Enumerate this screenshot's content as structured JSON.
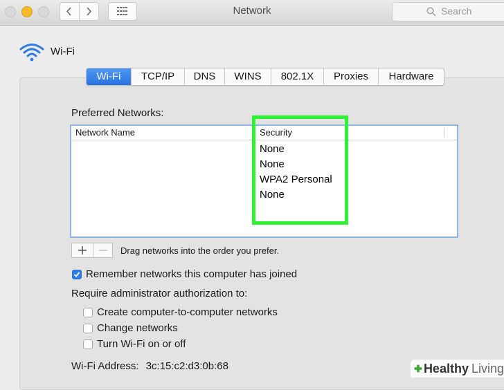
{
  "window": {
    "title": "Network"
  },
  "search": {
    "placeholder": "Search"
  },
  "header": {
    "label": "Wi-Fi"
  },
  "tabs": [
    {
      "label": "Wi-Fi",
      "active": true
    },
    {
      "label": "TCP/IP"
    },
    {
      "label": "DNS"
    },
    {
      "label": "WINS"
    },
    {
      "label": "802.1X"
    },
    {
      "label": "Proxies"
    },
    {
      "label": "Hardware"
    }
  ],
  "preferred": {
    "label": "Preferred Networks:",
    "columns": {
      "name": "Network Name",
      "security": "Security"
    },
    "rows": [
      {
        "name": "",
        "security": "None"
      },
      {
        "name": "",
        "security": "None"
      },
      {
        "name": "",
        "security": "WPA2 Personal"
      },
      {
        "name": "",
        "security": "None"
      }
    ],
    "drag_note": "Drag networks into the order you prefer."
  },
  "options": {
    "remember": {
      "label": "Remember networks this computer has joined",
      "checked": true
    },
    "require_label": "Require administrator authorization to:",
    "create": {
      "label": "Create computer-to-computer networks",
      "checked": false
    },
    "change": {
      "label": "Change networks",
      "checked": false
    },
    "toggle": {
      "label": "Turn Wi-Fi on or off",
      "checked": false
    }
  },
  "address": {
    "label": "Wi-Fi Address:",
    "value": "3c:15:c2:d3:0b:68"
  },
  "watermark": {
    "bold": "Healthy",
    "light": "Living"
  },
  "colors": {
    "accent": "#2a73e0",
    "highlight": "#2ef233",
    "traffic_yellow": "#f6b928"
  }
}
